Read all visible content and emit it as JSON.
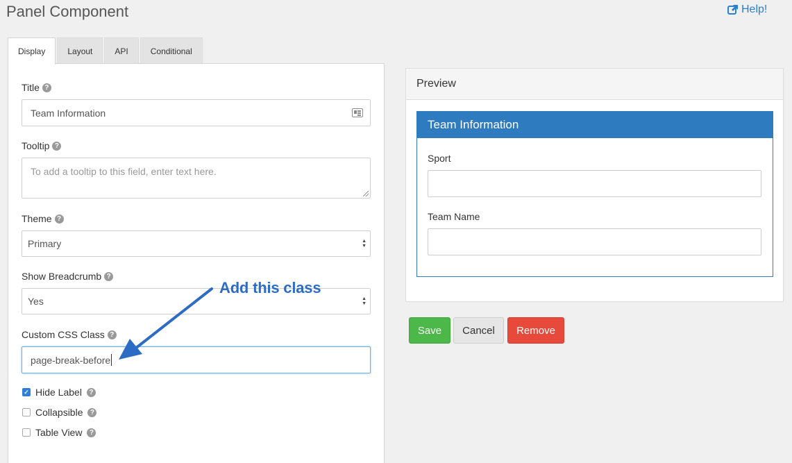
{
  "header": {
    "title": "Panel Component",
    "help_label": "Help!"
  },
  "tabs": [
    {
      "label": "Display",
      "active": true
    },
    {
      "label": "Layout",
      "active": false
    },
    {
      "label": "API",
      "active": false
    },
    {
      "label": "Conditional",
      "active": false
    }
  ],
  "form": {
    "title": {
      "label": "Title",
      "value": "Team Information"
    },
    "tooltip": {
      "label": "Tooltip",
      "placeholder": "To add a tooltip to this field, enter text here."
    },
    "theme": {
      "label": "Theme",
      "value": "Primary"
    },
    "breadcrumb": {
      "label": "Show Breadcrumb",
      "value": "Yes"
    },
    "css_class": {
      "label": "Custom CSS Class",
      "value": "page-break-before"
    },
    "checkboxes": [
      {
        "label": "Hide Label",
        "checked": true
      },
      {
        "label": "Collapsible",
        "checked": false
      },
      {
        "label": "Table View",
        "checked": false
      }
    ]
  },
  "annotation": {
    "text": "Add this class",
    "color": "#2d6cc4"
  },
  "preview": {
    "heading": "Preview",
    "panel_title": "Team Information",
    "fields": [
      {
        "label": "Sport"
      },
      {
        "label": "Team Name"
      }
    ]
  },
  "buttons": {
    "save": "Save",
    "cancel": "Cancel",
    "remove": "Remove"
  },
  "colors": {
    "accent": "#2f7bbf",
    "save": "#4cb849",
    "remove": "#e74a3b",
    "link": "#2a7fd1"
  }
}
